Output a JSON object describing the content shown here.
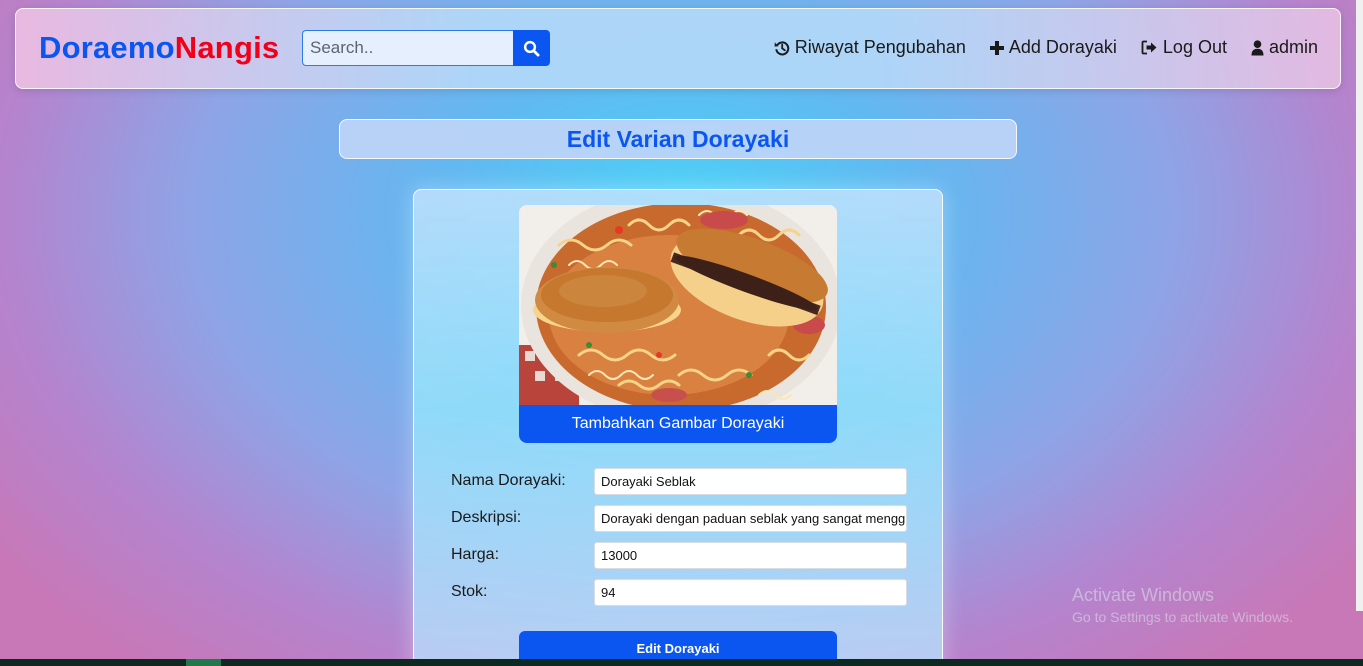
{
  "navbar": {
    "brand_part1": "Doraemo",
    "brand_part2": "Nangis",
    "search_placeholder": "Search..",
    "links": [
      {
        "label": "Riwayat Pengubahan",
        "icon": "history-icon"
      },
      {
        "label": "Add Dorayaki",
        "icon": "plus-icon"
      },
      {
        "label": "Log Out",
        "icon": "sign-out-icon"
      },
      {
        "label": "admin",
        "icon": "user-icon"
      }
    ]
  },
  "page": {
    "title": "Edit Varian Dorayaki"
  },
  "form": {
    "image_button": "Tambahkan Gambar Dorayaki",
    "fields": [
      {
        "label": "Nama Dorayaki:",
        "value": "Dorayaki Seblak"
      },
      {
        "label": "Deskripsi:",
        "value": "Dorayaki dengan paduan seblak yang sangat menggugah selera"
      },
      {
        "label": "Harga:",
        "value": "13000"
      },
      {
        "label": "Stok:",
        "value": "94"
      }
    ],
    "submit": "Edit Dorayaki"
  },
  "watermark": {
    "line1": "Activate Windows",
    "line2": "Go to Settings to activate Windows."
  },
  "colors": {
    "accent": "#0b56f0",
    "brand_red": "#f2001a"
  }
}
